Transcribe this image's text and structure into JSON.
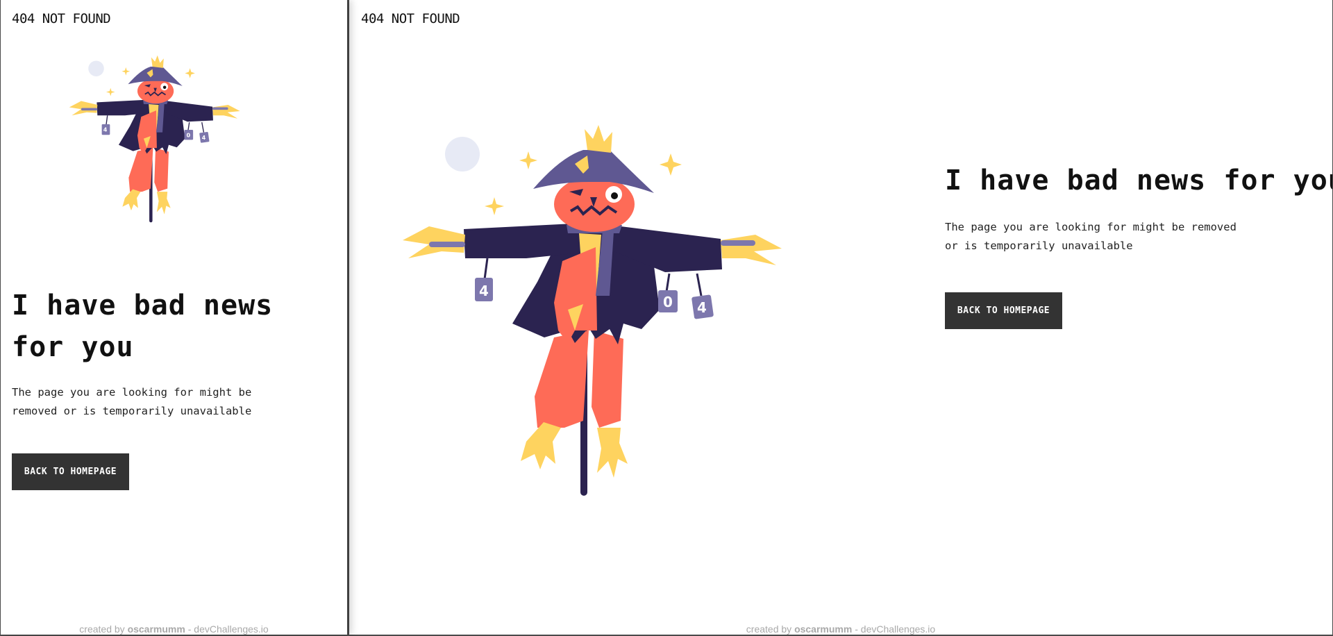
{
  "brand": {
    "text": "404 NOT FOUND"
  },
  "content": {
    "headline": "I have bad news for you",
    "subtext": "The page you are looking for might be removed or is temporarily unavailable",
    "button_label": "BACK TO HOMEPAGE"
  },
  "footer": {
    "created_by": "created by",
    "author": "oscarmumm",
    "separator": " - ",
    "site": "devChallenges.io"
  },
  "illustration": {
    "icon": "scarecrow-illustration",
    "cans": [
      "4",
      "0",
      "4"
    ],
    "colors": {
      "coat": "#2b2350",
      "hat": "#5f5892",
      "head": "#fe6b57",
      "straw": "#fed35f",
      "can": "#7d77ad",
      "moon": "#e7eaf5"
    }
  }
}
